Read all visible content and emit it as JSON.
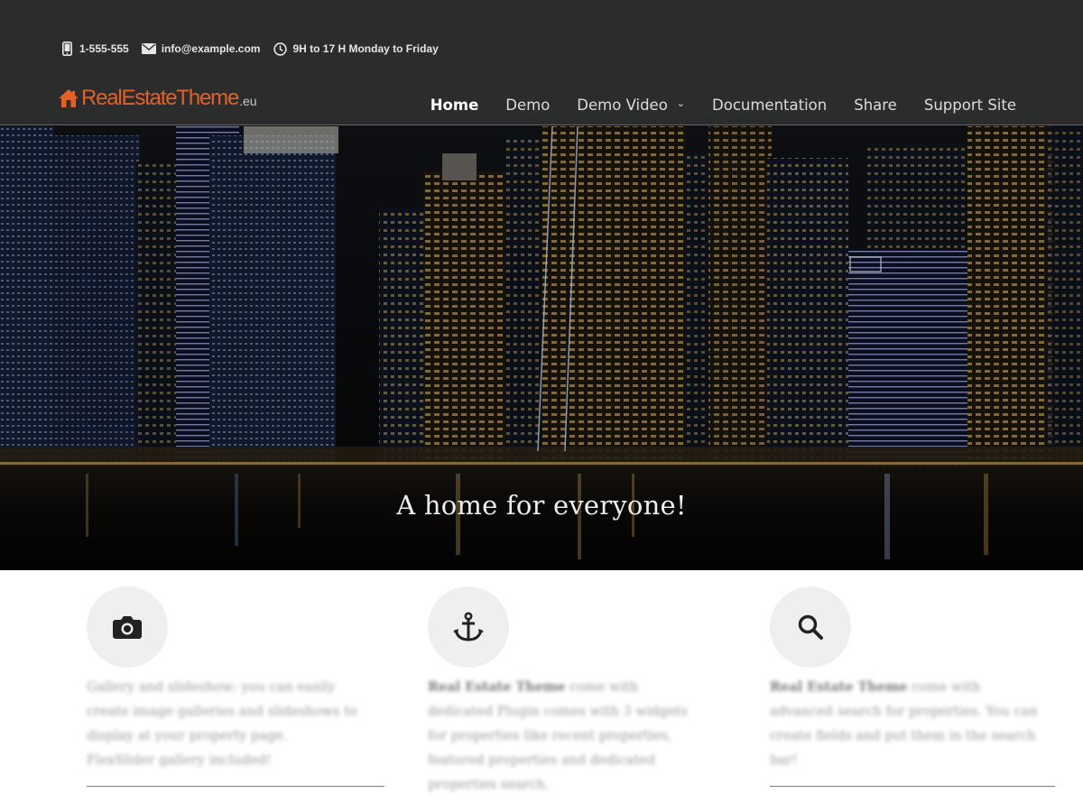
{
  "topbar": {
    "phone": "1-555-555",
    "email": "info@example.com",
    "hours": "9H to 17 H Monday to Friday",
    "icons": [
      "phone-icon",
      "envelope-icon",
      "clock-icon"
    ]
  },
  "logo": {
    "name": "RealEstateTheme",
    "tld": ".eu",
    "icon": "house-icon"
  },
  "nav": {
    "items": [
      {
        "label": "Home",
        "active": true
      },
      {
        "label": "Demo"
      },
      {
        "label": "Demo Video",
        "has_dropdown": true
      },
      {
        "label": "Documentation"
      },
      {
        "label": "Share"
      },
      {
        "label": "Support Site"
      }
    ]
  },
  "hero": {
    "tagline": "A home for everyone!"
  },
  "features": [
    {
      "icon": "camera-icon",
      "bold": "",
      "text": "Gallery and slideshow: you can easily create image galleries and slideshows to display at your property page. FlexSlider gallery included!"
    },
    {
      "icon": "anchor-icon",
      "bold": "Real Estate Theme",
      "text": " come with dedicated Plugin comes with 3 widgets for properties like recent properties, featured properties and dedicated properties search."
    },
    {
      "icon": "search-icon",
      "bold": "Real Estate Theme",
      "text": " come with advanced search for properties. You can create fields and put them in the search bar!"
    }
  ],
  "colors": {
    "logo_orange": "#e0622a",
    "topbar_bg": "#303030",
    "nav_text": "#dcdcdc"
  }
}
